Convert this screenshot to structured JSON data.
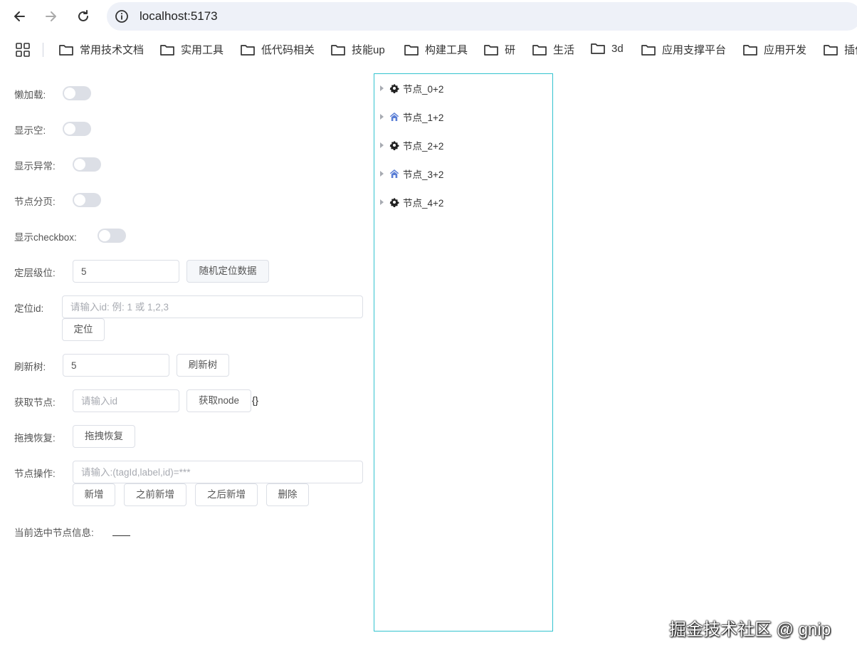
{
  "browser": {
    "url": "localhost:5173",
    "bookmarks": [
      "常用技术文档",
      "实用工具",
      "低代码相关",
      "技能up",
      "构建工具",
      "研",
      "生活",
      "3d",
      "应用支撑平台",
      "应用开发",
      "插件"
    ]
  },
  "form": {
    "lazy_load_label": "懒加载:",
    "show_empty_label": "显示空:",
    "show_error_label": "显示异常:",
    "node_paging_label": "节点分页:",
    "show_checkbox_label": "显示checkbox:",
    "locate_level_label": "定层级位:",
    "locate_level_value": "5",
    "random_locate_button": "随机定位数据",
    "locate_id_label": "定位id:",
    "locate_id_placeholder": "请输入id: 例: 1 或 1,2,3",
    "locate_button": "定位",
    "refresh_tree_label": "刷新树:",
    "refresh_tree_value": "5",
    "refresh_tree_button": "刷新树",
    "get_node_label": "获取节点:",
    "get_node_placeholder": "请输入id",
    "get_node_button": "获取node",
    "get_node_result": "{}",
    "drag_restore_label": "拖拽恢复:",
    "drag_restore_button": "拖拽恢复",
    "node_op_label": "节点操作:",
    "node_op_placeholder": "请输入:(tagId,label,id)=***",
    "add_button": "新增",
    "add_before_button": "之前新增",
    "add_after_button": "之后新增",
    "delete_button": "删除",
    "selected_info_label": "当前选中节点信息:"
  },
  "tree": {
    "nodes": [
      {
        "label": "节点_0+2",
        "icon": "gear-icon"
      },
      {
        "label": "节点_1+2",
        "icon": "home-icon"
      },
      {
        "label": "节点_2+2",
        "icon": "gear-icon"
      },
      {
        "label": "节点_3+2",
        "icon": "home-icon"
      },
      {
        "label": "节点_4+2",
        "icon": "gear-icon"
      }
    ]
  },
  "watermark": "掘金技术社区 @ gnip",
  "colors": {
    "tree_border": "#33c3cf",
    "home_icon": "#5b7fd6",
    "switch_off": "#dcdfe6"
  }
}
